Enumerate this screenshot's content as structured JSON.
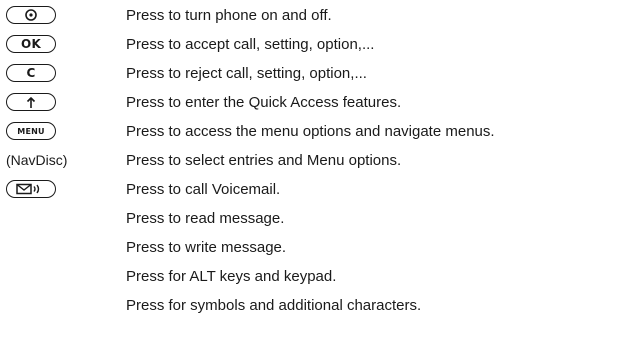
{
  "rows": [
    {
      "key_icon": "power-icon",
      "description": "Press to turn phone on and off."
    },
    {
      "key_text": "OK",
      "description": "Press to accept call, setting, option,..."
    },
    {
      "key_text": "C",
      "description": "Press to reject call, setting, option,..."
    },
    {
      "key_icon": "up-arrow-icon",
      "description": "Press to enter the Quick Access features."
    },
    {
      "key_text": "MENU",
      "description": "Press to access the menu options and navigate menus."
    },
    {
      "key_label": "(NavDisc)",
      "description": "Press to select entries and Menu options."
    },
    {
      "key_icon": "voicemail-icon",
      "description": "Press to call Voicemail."
    },
    {
      "description": "Press to read message."
    },
    {
      "description": "Press to write message."
    },
    {
      "description": "Press for ALT keys and keypad."
    },
    {
      "description": "Press for symbols and additional characters."
    }
  ]
}
